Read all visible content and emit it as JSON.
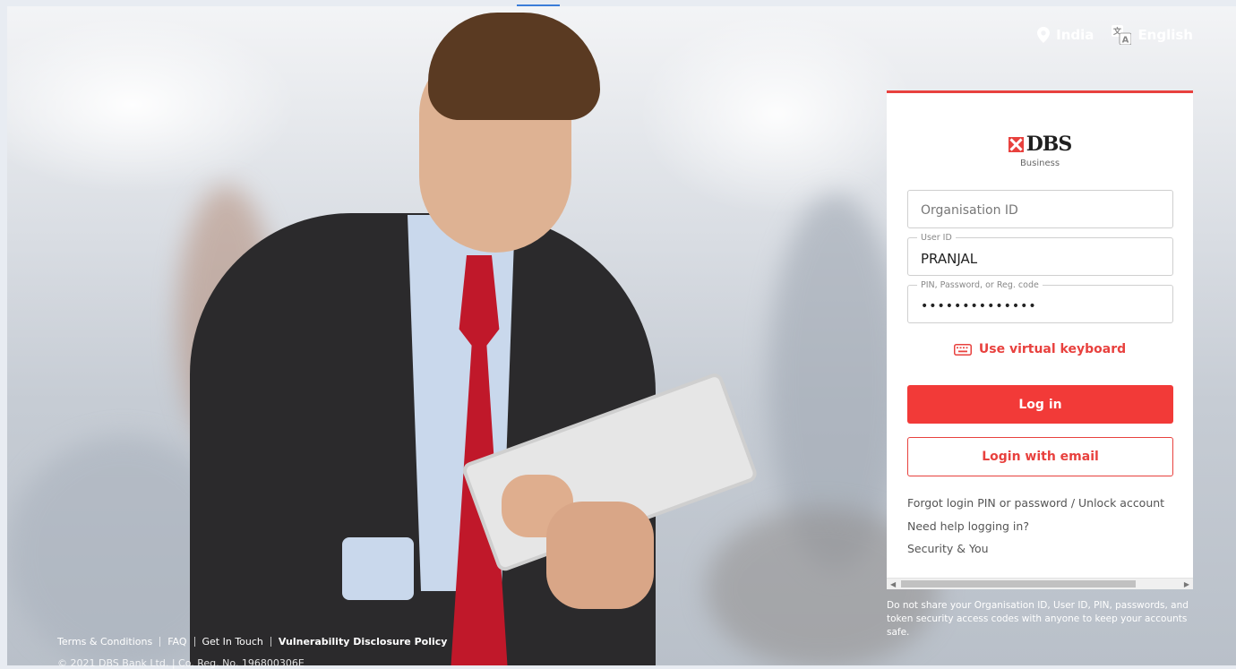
{
  "locale": {
    "country": "India",
    "language": "English"
  },
  "brand": {
    "name": "DBS",
    "subtitle": "Business",
    "accent": "#e8413e"
  },
  "form": {
    "org_id_placeholder": "Organisation ID",
    "user_id_label": "User ID",
    "user_id_value": "PRANJAL",
    "password_label": "PIN, Password, or Reg. code",
    "password_mask": "••••••••••••••",
    "virtual_keyboard": "Use virtual keyboard",
    "login_button": "Log in",
    "login_email_button": "Login with email"
  },
  "links": [
    "Forgot login PIN or password / Unlock account",
    "Need help logging in?",
    "Security & You"
  ],
  "disclaimer": "Do not share your Organisation ID, User ID, PIN, passwords, and token security access codes with anyone to keep your accounts safe.",
  "footer": {
    "links": [
      "Terms & Conditions",
      "FAQ",
      "Get In Touch",
      "Vulnerability Disclosure Policy"
    ],
    "copyright": "© 2021 DBS Bank Ltd. | Co. Reg. No. 196800306E"
  }
}
